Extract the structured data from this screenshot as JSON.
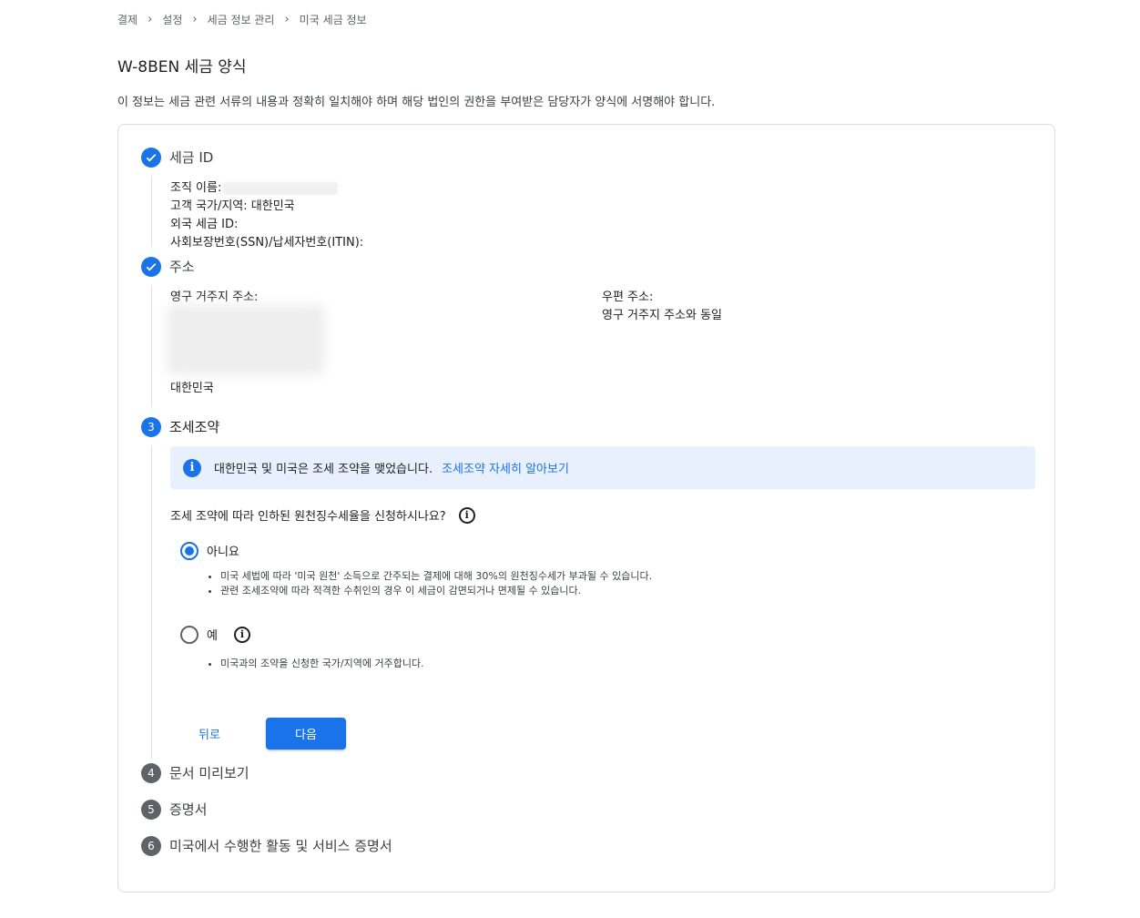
{
  "breadcrumb": [
    "결제",
    "설정",
    "세금 정보 관리",
    "미국 세금 정보"
  ],
  "page": {
    "title": "W-8BEN 세금 양식",
    "description": "이 정보는 세금 관련 서류의 내용과 정확히 일치해야 하며 해당 법인의 권한을 부여받은 담당자가 양식에 서명해야 합니다."
  },
  "steps": {
    "tax_id": {
      "title": "세금 ID",
      "org_name_label": "조직 이름:",
      "country": "고객 국가/지역: 대한민국",
      "foreign_tax_id": "외국 세금 ID:",
      "ssn_itin": "사회보장번호(SSN)/납세자번호(ITIN):"
    },
    "address": {
      "title": "주소",
      "permanent_label": "영구 거주지 주소:",
      "country": "대한민국",
      "mailing_label": "우편 주소:",
      "mailing_value": "영구 거주지 주소와 동일"
    },
    "treaty": {
      "number": "3",
      "title": "조세조약",
      "info_text": "대한민국 및 미국은 조세 조약을 맺었습니다.",
      "info_link": "조세조약 자세히 알아보기",
      "question": "조세 조약에 따라 인하된 원천징수세율을 신청하시나요?",
      "option_no": {
        "label": "아니요",
        "selected": true,
        "bullets": [
          "미국 세법에 따라 '미국 원천' 소득으로 간주되는 결제에 대해 30%의 원천징수세가 부과될 수 있습니다.",
          "관련 조세조약에 따라 적격한 수취인의 경우 이 세금이 감면되거나 면제될 수 있습니다."
        ]
      },
      "option_yes": {
        "label": "예",
        "selected": false,
        "bullets": [
          "미국과의 조약을 신청한 국가/지역에 거주합니다."
        ]
      },
      "back_label": "뒤로",
      "next_label": "다음"
    },
    "preview": {
      "number": "4",
      "title": "문서 미리보기"
    },
    "certificate": {
      "number": "5",
      "title": "증명서"
    },
    "us_activities": {
      "number": "6",
      "title": "미국에서 수행한 활동 및 서비스 증명서"
    }
  },
  "colors": {
    "primary": "#1a73e8",
    "info_bg": "#e8f0fe",
    "todo": "#5f6368"
  }
}
